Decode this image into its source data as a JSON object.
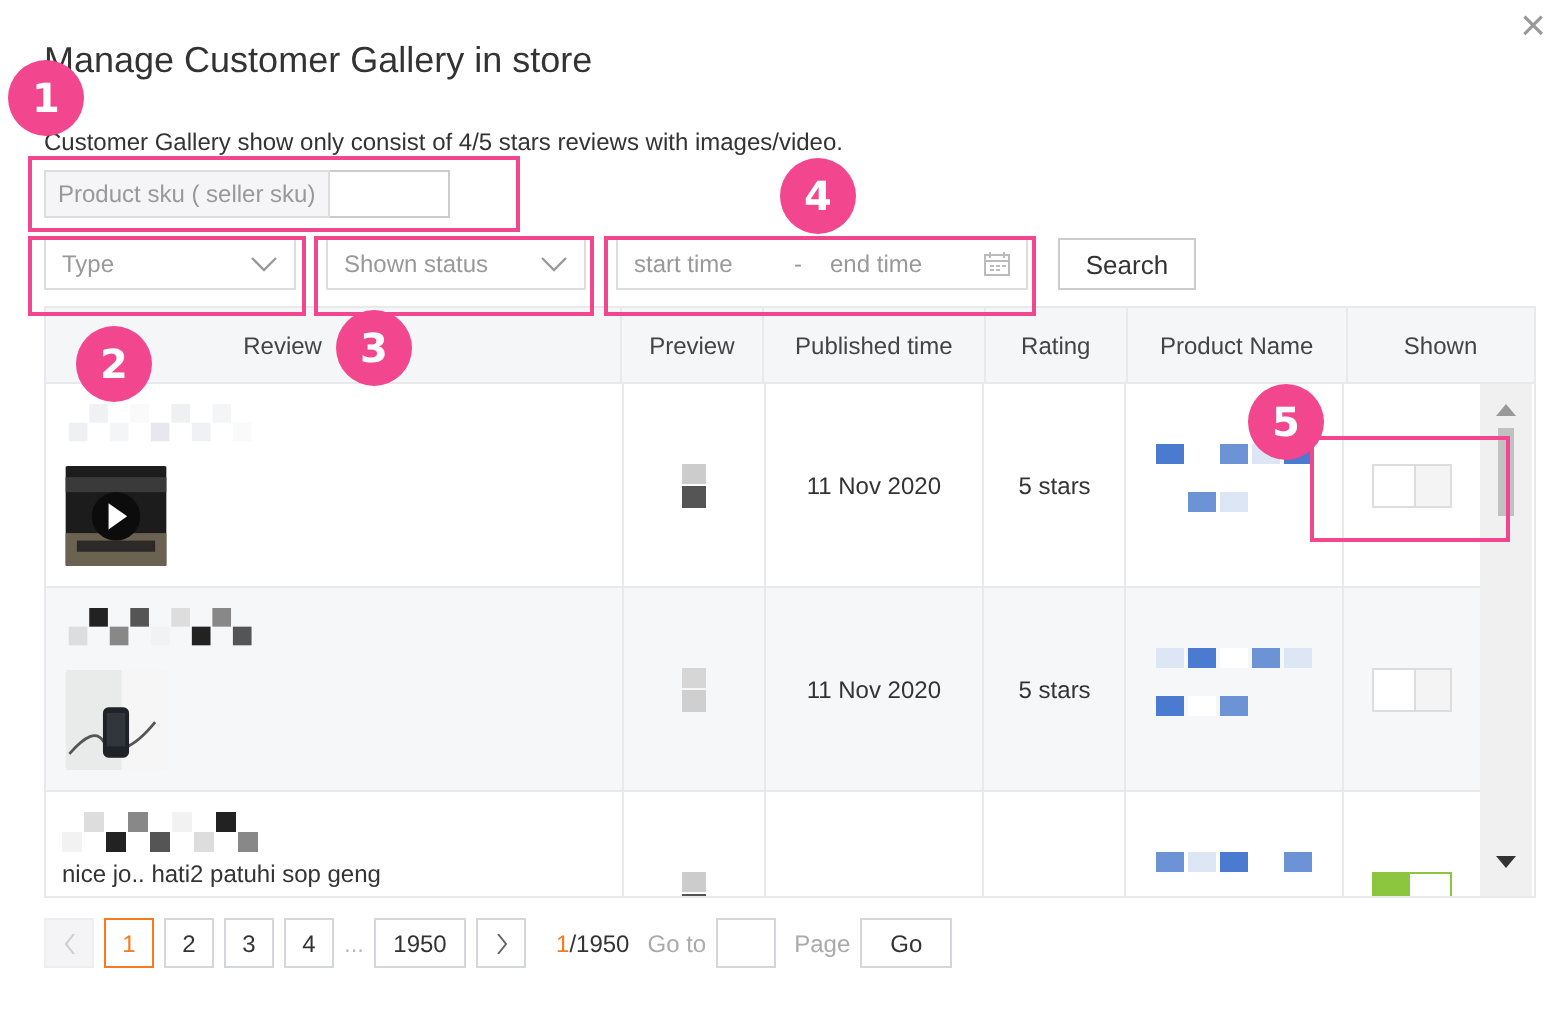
{
  "dialog": {
    "title": "Manage Customer Gallery in store",
    "close": "×",
    "description": "Customer Gallery show only consist of 4/5 stars reviews with images/video."
  },
  "filters": {
    "sku_label": "Product sku ( seller sku)",
    "type_placeholder": "Type",
    "status_placeholder": "Shown status",
    "start_placeholder": "start time",
    "separator": "-",
    "end_placeholder": "end time",
    "search": "Search"
  },
  "table": {
    "columns": [
      "Review",
      "Preview",
      "Published time",
      "Rating",
      "Product Name",
      "Shown"
    ],
    "rows": [
      {
        "kind": "video",
        "published": "11 Nov 2020",
        "rating": "5 stars",
        "shown": false
      },
      {
        "published": "11 Nov 2020",
        "rating": "5 stars",
        "shown": false
      },
      {
        "kind": "text",
        "review_text": "nice jo.. hati2 patuhi sop geng",
        "shown": true
      }
    ]
  },
  "pagination": {
    "pages": [
      {
        "label": "1",
        "selected": true
      },
      {
        "label": "2",
        "selected": false
      },
      {
        "label": "3",
        "selected": false
      },
      {
        "label": "4",
        "selected": false
      }
    ],
    "ellipsis": "...",
    "last_page": {
      "label": "1950",
      "selected": false
    },
    "current": "1",
    "total": "/1950",
    "goto_label": "Go to",
    "page_label": "Page",
    "go": "Go"
  },
  "annotations": [
    {
      "number": "1"
    },
    {
      "number": "2"
    },
    {
      "number": "3"
    },
    {
      "number": "4"
    },
    {
      "number": "5"
    }
  ]
}
